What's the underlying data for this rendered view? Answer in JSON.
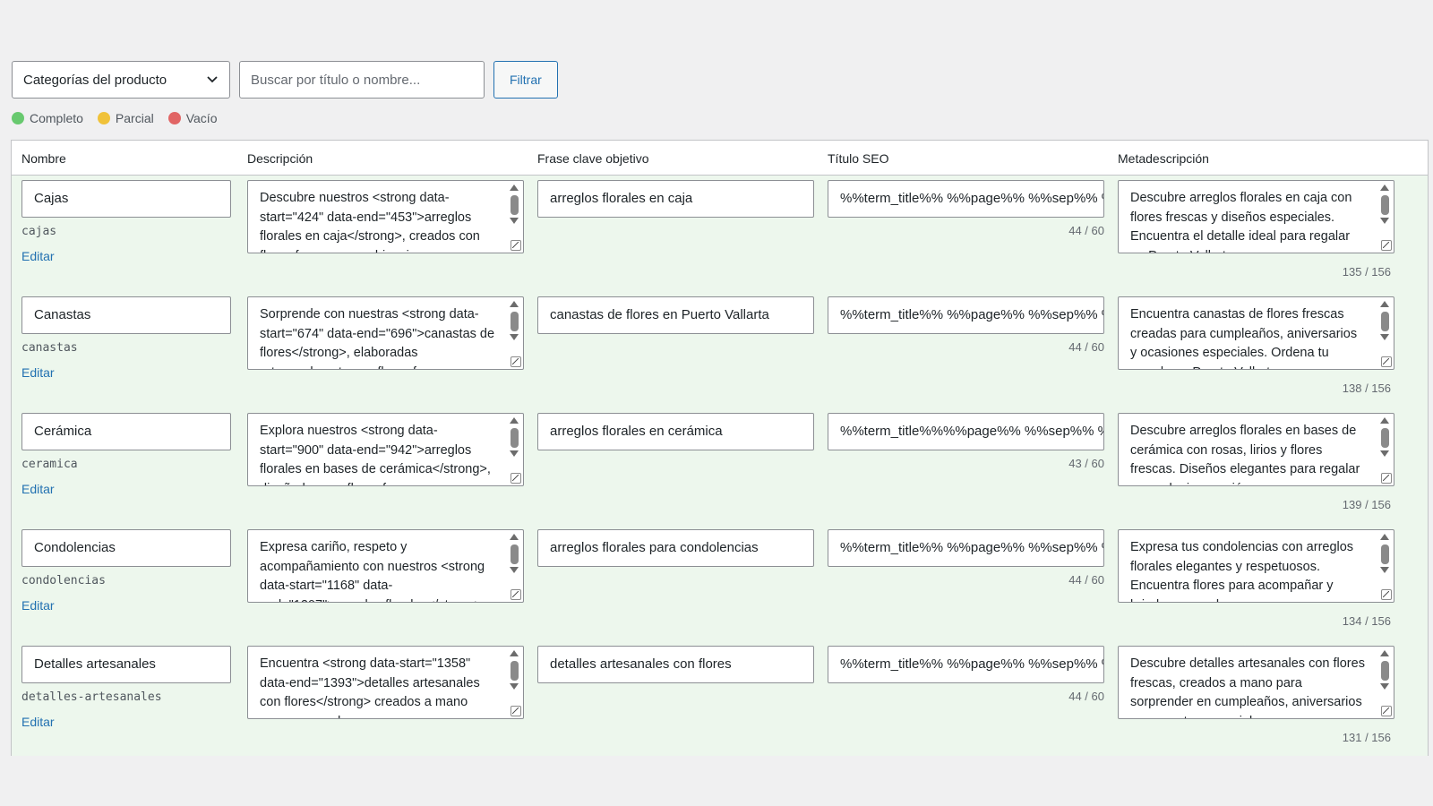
{
  "toolbar": {
    "category_select": "Categorías del producto",
    "search_placeholder": "Buscar por título o nombre...",
    "filter_label": "Filtrar"
  },
  "legend": [
    {
      "label": "Completo",
      "color": "#68c96f"
    },
    {
      "label": "Parcial",
      "color": "#f0c23a"
    },
    {
      "label": "Vacío",
      "color": "#e16565"
    }
  ],
  "columns": {
    "name": "Nombre",
    "description": "Descripción",
    "keyword": "Frase clave objetivo",
    "seo_title": "Título SEO",
    "meta": "Metadescripción"
  },
  "edit_label": "Editar",
  "rows": [
    {
      "name": "Cajas",
      "slug": "cajas",
      "description": "Descubre nuestros <strong data-start=\"424\" data-end=\"453\">arreglos florales en caja</strong>, creados con flores frescas y combinaciones",
      "keyword": "arreglos florales en caja",
      "seo_title": "%%term_title%% %%page%% %%sep%% %%sitename%%",
      "seo_count": "44 / 60",
      "meta": "Descubre arreglos florales en caja con flores frescas y diseños especiales. Encuentra el detalle ideal para regalar en Puerto Vallarta.",
      "meta_count": "135 / 156"
    },
    {
      "name": "Canastas",
      "slug": "canastas",
      "description": "Sorprende con nuestras <strong data-start=\"674\" data-end=\"696\">canastas de flores</strong>, elaboradas artesanalmente con flores frescas",
      "keyword": "canastas de flores en Puerto Vallarta",
      "seo_title": "%%term_title%% %%page%% %%sep%% %%sitename%%",
      "seo_count": "44 / 60",
      "meta": "Encuentra canastas de flores frescas creadas para cumpleaños, aniversarios y ocasiones especiales. Ordena tu arreglo en Puerto Vallarta.",
      "meta_count": "138 / 156"
    },
    {
      "name": "Cerámica",
      "slug": "ceramica",
      "description": "Explora nuestros <strong data-start=\"900\" data-end=\"942\">arreglos florales en bases de cerámica</strong>, diseñados con flores frescas",
      "keyword": "arreglos florales en cerámica",
      "seo_title": "%%term_title%%%%page%% %%sep%% %%sitename%%",
      "seo_count": "43 / 60",
      "meta": "Descubre arreglos florales en bases de cerámica con rosas, lirios y flores frescas. Diseños elegantes para regalar en cualquier ocasión.",
      "meta_count": "139 / 156"
    },
    {
      "name": "Condolencias",
      "slug": "condolencias",
      "description": "Expresa cariño, respeto y acompañamiento con nuestros <strong data-start=\"1168\" data-end=\"1207\">arreglos florales</strong>",
      "keyword": "arreglos florales para condolencias",
      "seo_title": "%%term_title%% %%page%% %%sep%% %%sitename%%",
      "seo_count": "44 / 60",
      "meta": "Expresa tus condolencias con arreglos florales elegantes y respetuosos. Encuentra flores para acompañar y brindar consuelo.",
      "meta_count": "134 / 156"
    },
    {
      "name": "Detalles artesanales",
      "slug": "detalles-artesanales",
      "description": "Encuentra <strong data-start=\"1358\" data-end=\"1393\">detalles artesanales con flores</strong> creados a mano para sorprender",
      "keyword": "detalles artesanales con flores",
      "seo_title": "%%term_title%% %%page%% %%sep%% %%sitename%%",
      "seo_count": "44 / 60",
      "meta": "Descubre detalles artesanales con flores frescas, creados a mano para sorprender en cumpleaños, aniversarios y momentos especiales.",
      "meta_count": "131 / 156"
    }
  ]
}
